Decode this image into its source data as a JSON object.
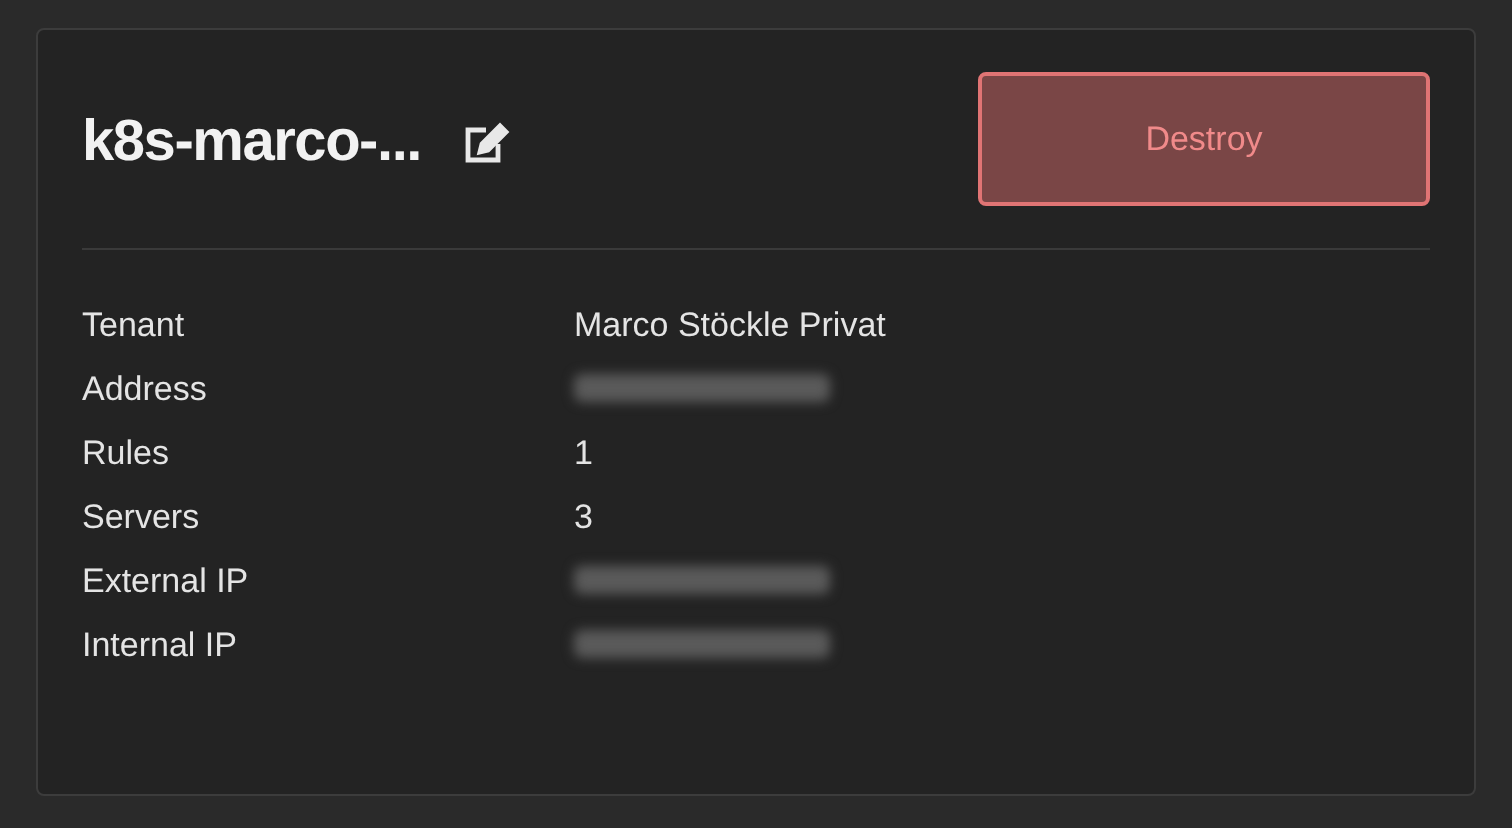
{
  "title": "k8s-marco-...",
  "destroy_button": "Destroy",
  "details": [
    {
      "label": "Tenant",
      "value": "Marco Stöckle Privat",
      "redacted": false
    },
    {
      "label": "Address",
      "redacted": true
    },
    {
      "label": "Rules",
      "value": "1",
      "redacted": false
    },
    {
      "label": "Servers",
      "value": "3",
      "redacted": false
    },
    {
      "label": "External IP",
      "redacted": true
    },
    {
      "label": "Internal IP",
      "redacted": true
    }
  ]
}
